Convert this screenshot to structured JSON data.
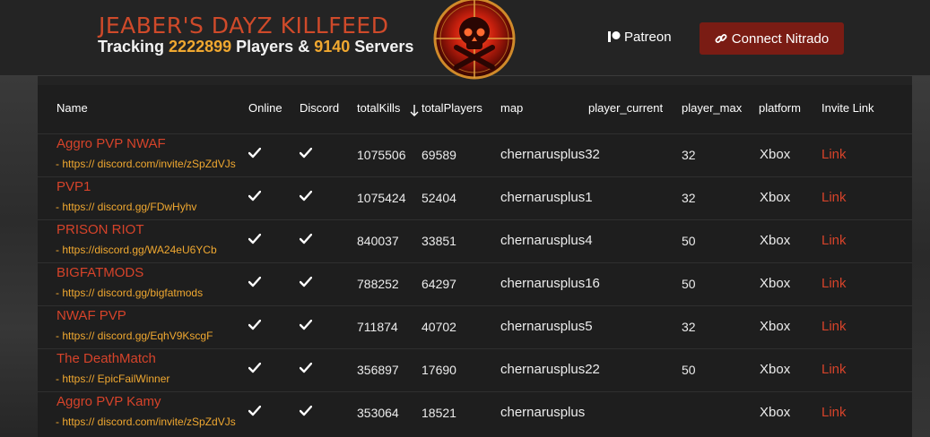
{
  "header": {
    "title": "JEABER'S DAYZ KILLFEED",
    "sub_prefix": "Tracking",
    "players_count": "2222899",
    "sub_middle": "Players &",
    "servers_count": "9140",
    "sub_suffix": "Servers",
    "patreon_label": "Patreon",
    "nitrado_label": "Connect Nitrado"
  },
  "colors": {
    "accent_red": "#d6432a",
    "accent_orange": "#f0a830",
    "button_red": "#7a1c14",
    "background": "#232323"
  },
  "table": {
    "columns": [
      "Name",
      "Online",
      "Discord",
      "totalKills",
      "totalPlayers",
      "map",
      "player_current",
      "player_max",
      "platform",
      "Invite Link"
    ],
    "sorted_column": "totalPlayers",
    "rows": [
      {
        "name": "Aggro PVP NWAF",
        "discord": "- https:// discord.com/invite/zSpZdVJs",
        "kills": "1075506",
        "players": "69589",
        "map": "chernarusplus32",
        "player_current": "",
        "player_max": "32",
        "platform": "Xbox",
        "link": "Link"
      },
      {
        "name": "PVP1",
        "discord": "- https:// discord.gg/FDwHyhv",
        "kills": "1075424",
        "players": "52404",
        "map": "chernarusplus1",
        "player_current": "",
        "player_max": "32",
        "platform": "Xbox",
        "link": "Link"
      },
      {
        "name": "PRISON RIOT",
        "discord": "- https://discord.gg/WA24eU6YCb",
        "kills": "840037",
        "players": "33851",
        "map": "chernarusplus4",
        "player_current": "",
        "player_max": "50",
        "platform": "Xbox",
        "link": "Link"
      },
      {
        "name": "BIGFATMODS",
        "discord": "- https:// discord.gg/bigfatmods",
        "kills": "788252",
        "players": "64297",
        "map": "chernarusplus16",
        "player_current": "",
        "player_max": "50",
        "platform": "Xbox",
        "link": "Link"
      },
      {
        "name": "NWAF PVP",
        "discord": "- https:// discord.gg/EqhV9KscgF",
        "kills": "711874",
        "players": "40702",
        "map": "chernarusplus5",
        "player_current": "",
        "player_max": "32",
        "platform": "Xbox",
        "link": "Link"
      },
      {
        "name": "The DeathMatch",
        "discord": "- https:// EpicFailWinner",
        "kills": "356897",
        "players": "17690",
        "map": "chernarusplus22",
        "player_current": "",
        "player_max": "50",
        "platform": "Xbox",
        "link": "Link"
      },
      {
        "name": "Aggro PVP Kamy",
        "discord": "- https:// discord.com/invite/zSpZdVJs",
        "kills": "353064",
        "players": "18521",
        "map": "chernarusplus",
        "player_current": "",
        "player_max": "",
        "platform": "Xbox",
        "link": "Link"
      }
    ]
  }
}
